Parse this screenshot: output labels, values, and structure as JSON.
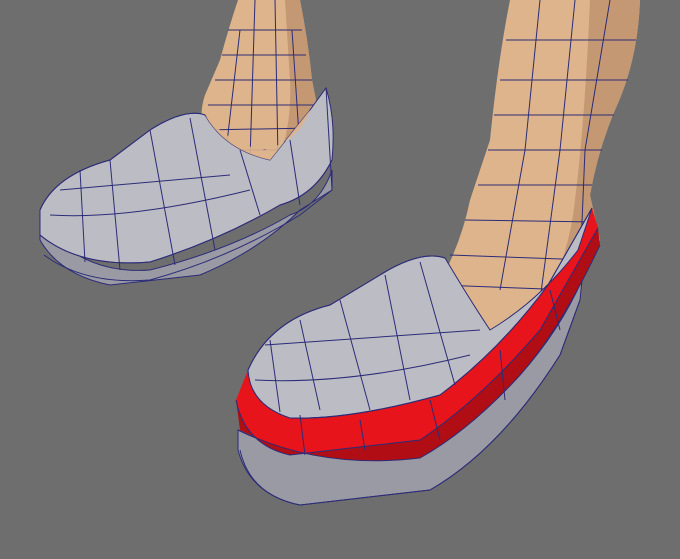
{
  "viewport": {
    "background": "#6e6e6e",
    "wire": "#2c2c78",
    "skin": "#deb48c",
    "skin_shade": "#c39873",
    "shoe": "#bcbcc4",
    "shoe_shade": "#9a9aa4",
    "selection": "#e8141b",
    "selection_dark": "#b00e14"
  }
}
